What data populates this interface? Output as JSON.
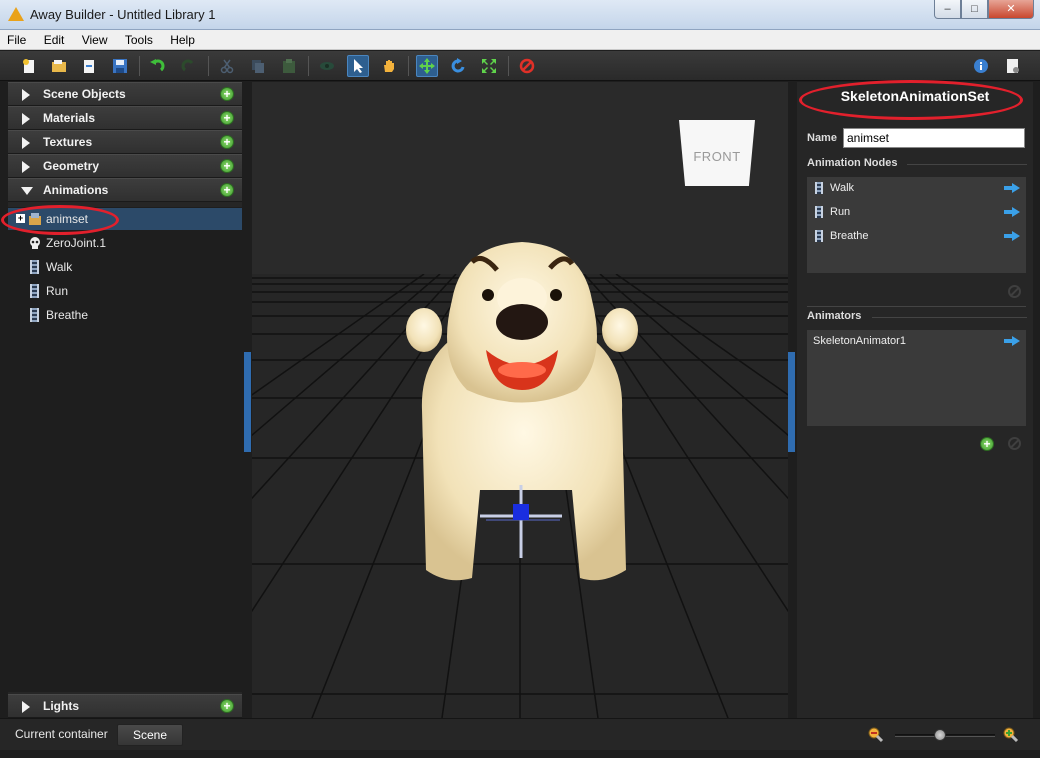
{
  "window": {
    "title": "Away Builder - Untitled Library 1",
    "controls": {
      "minimize": "–",
      "maximize": "□",
      "close": "✕"
    }
  },
  "menubar": {
    "items": [
      "File",
      "Edit",
      "View",
      "Tools",
      "Help"
    ]
  },
  "toolbar": {
    "icons": [
      "new-document-icon",
      "open-folder-icon",
      "import-icon",
      "save-icon",
      "undo-icon",
      "redo-icon",
      "cut-icon",
      "copy-icon",
      "paste-icon",
      "visibility-icon",
      "select-arrow-icon",
      "pan-hand-icon",
      "move-icon",
      "rotate-icon",
      "scale-icon",
      "delete-icon",
      "info-icon",
      "settings-document-icon"
    ],
    "active": [
      "select-arrow-icon",
      "move-icon"
    ]
  },
  "library": {
    "sections": [
      {
        "label": "Scene Objects",
        "expanded": false
      },
      {
        "label": "Materials",
        "expanded": false
      },
      {
        "label": "Textures",
        "expanded": false
      },
      {
        "label": "Geometry",
        "expanded": false
      },
      {
        "label": "Animations",
        "expanded": true
      }
    ],
    "tree": [
      {
        "label": "animset",
        "selected": true,
        "icon": "animation-set-icon",
        "expander": "+"
      },
      {
        "label": "ZeroJoint.1",
        "icon": "skeleton-skull-icon"
      },
      {
        "label": "Walk",
        "icon": "film-strip-icon"
      },
      {
        "label": "Run",
        "icon": "film-strip-icon"
      },
      {
        "label": "Breathe",
        "icon": "film-strip-icon"
      }
    ],
    "lights": {
      "label": "Lights"
    },
    "add_symbol": "+"
  },
  "viewport": {
    "cube_face": "FRONT"
  },
  "properties": {
    "title": "SkeletonAnimationSet",
    "name_label": "Name",
    "name_value": "animset",
    "nodes_heading": "Animation Nodes",
    "nodes": [
      "Walk",
      "Run",
      "Breathe"
    ],
    "animators_heading": "Animators",
    "animators": [
      "SkeletonAnimator1"
    ]
  },
  "statusbar": {
    "container_label": "Current container",
    "container_button": "Scene",
    "zoom_level": 0.45
  },
  "colors": {
    "accent": "#2f6cb0",
    "annotation": "#e2202c",
    "add_green": "#3b9a2a",
    "arrow_blue": "#3aa0e8"
  }
}
